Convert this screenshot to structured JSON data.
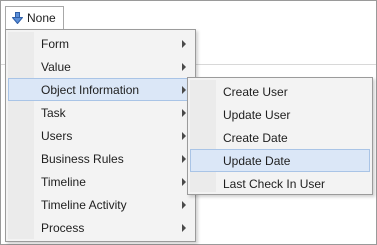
{
  "toolbar": {
    "dropdown_label": "None",
    "dropdown_icon": "arrow-down-icon",
    "accent": "#3a7bd5"
  },
  "main_menu": {
    "items": [
      {
        "label": "Form",
        "has_submenu": true
      },
      {
        "label": "Value",
        "has_submenu": true
      },
      {
        "label": "Object Information",
        "has_submenu": true,
        "active": true
      },
      {
        "label": "Task",
        "has_submenu": true
      },
      {
        "label": "Users",
        "has_submenu": true
      },
      {
        "label": "Business Rules",
        "has_submenu": true
      },
      {
        "label": "Timeline",
        "has_submenu": true
      },
      {
        "label": "Timeline Activity",
        "has_submenu": true
      },
      {
        "label": "Process",
        "has_submenu": true
      }
    ]
  },
  "sub_menu": {
    "items": [
      {
        "label": "Create User"
      },
      {
        "label": "Update User"
      },
      {
        "label": "Create Date"
      },
      {
        "label": "Update Date",
        "hover": true
      },
      {
        "label": "Last Check In User"
      }
    ]
  },
  "colors": {
    "menu_background": "#f3f3f3",
    "highlight_background": "#dbe7f7",
    "highlight_border": "#a9c4e6"
  }
}
